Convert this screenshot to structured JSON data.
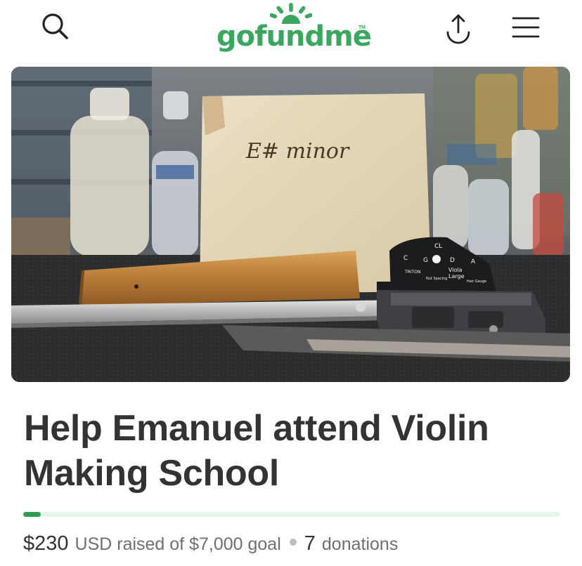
{
  "header": {
    "brand": "gofundme",
    "trademark": "TM",
    "brand_color": "#3aa660",
    "icons": {
      "search": "search-icon",
      "share": "share-upload-icon",
      "menu": "hamburger-menu-icon"
    }
  },
  "hero": {
    "image": "campaign-photo-violin-workshop",
    "sign_text": "E# minor",
    "gauge_labels": [
      "C",
      "G",
      "D",
      "A",
      "CL",
      "Viola",
      "Large",
      "TRITON",
      "Nut Spacing",
      "Hair Gauge"
    ]
  },
  "campaign": {
    "title": "Help Emanuel attend Violin Making School",
    "progress": {
      "raised": 230,
      "goal": 7000,
      "fraction": 0.033,
      "fill_color": "#2e9e54",
      "track_color": "#e6f5ec"
    },
    "raised_amount": "$230",
    "raised_text": "USD raised of $7,000 goal",
    "donations_count": "7",
    "donations_label": "donations"
  }
}
